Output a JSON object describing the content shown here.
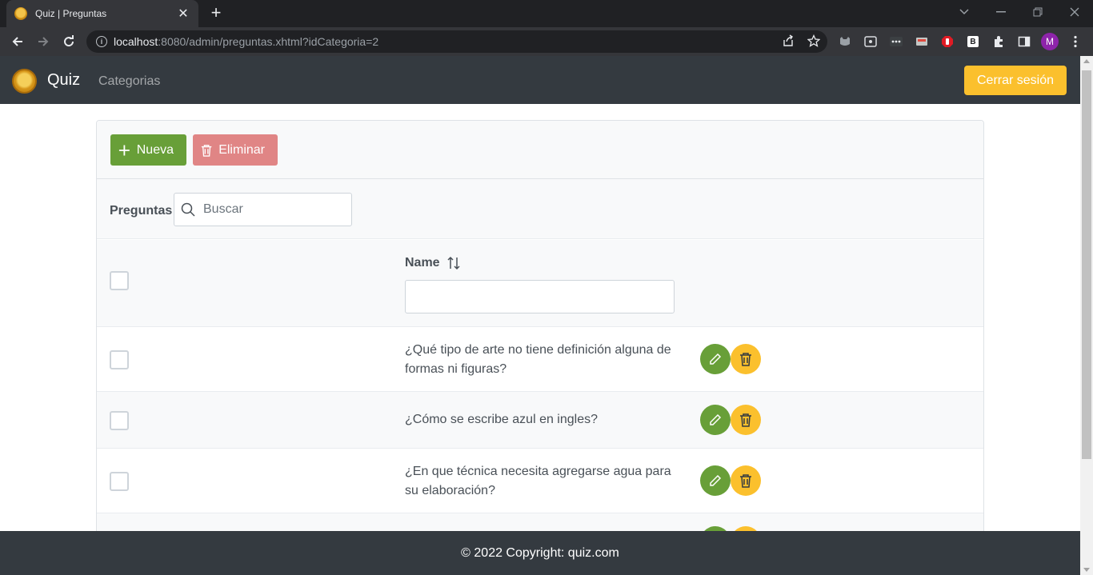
{
  "browser": {
    "tab_title": "Quiz | Preguntas",
    "tab_close": "✕",
    "new_tab": "+",
    "url_host": "localhost",
    "url_rest": ":8080/admin/preguntas.xhtml?idCategoria=2",
    "profile_initial": "M",
    "ext_b_label": "B"
  },
  "navbar": {
    "brand": "Quiz",
    "link_categorias": "Categorias",
    "logout_label": "Cerrar sesión"
  },
  "toolbar": {
    "new_label": "Nueva",
    "delete_label": "Eliminar"
  },
  "table": {
    "title": "Preguntas",
    "search_placeholder": "Buscar",
    "column_name": "Name",
    "rows": [
      {
        "text": "¿Qué tipo de arte no tiene definición alguna de formas ni figuras?"
      },
      {
        "text": "¿Cómo se escribe azul en ingles?"
      },
      {
        "text": "¿En que técnica necesita agregarse agua para su elaboración?"
      }
    ]
  },
  "footer": {
    "copyright": "© 2022 Copyright: quiz.com"
  },
  "colors": {
    "navbar_bg": "#343a40",
    "success": "#689f38",
    "danger_light": "#e08585",
    "warning": "#fbc02d"
  }
}
